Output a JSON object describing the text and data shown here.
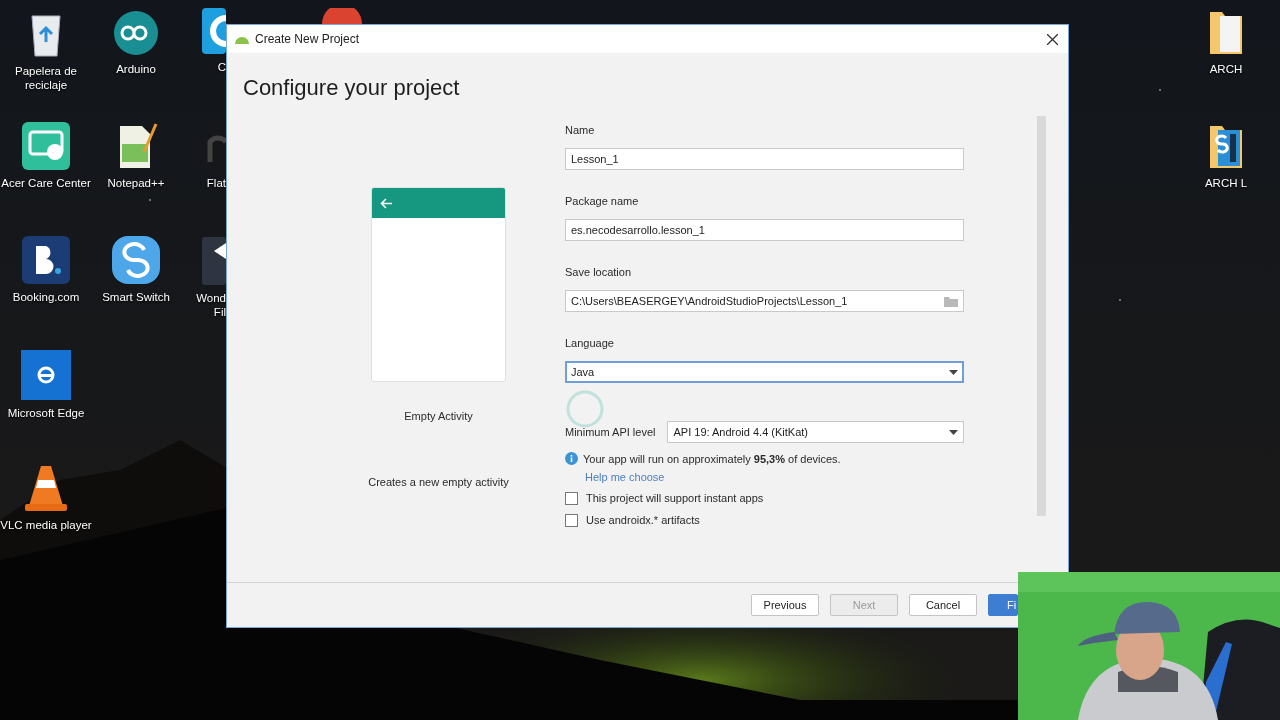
{
  "desktop": {
    "icons": [
      {
        "kind": "recycle-bin",
        "lines": [
          "Papelera de",
          "reciclaje"
        ]
      },
      {
        "kind": "arduino",
        "lines": [
          "Arduino"
        ]
      },
      {
        "kind": "cut-blue",
        "lines": [
          "C"
        ]
      },
      {
        "kind": "cut-red"
      },
      {
        "kind": "acer",
        "lines": [
          "Acer Care Center"
        ]
      },
      {
        "kind": "notepad",
        "lines": [
          "Notepad++"
        ]
      },
      {
        "kind": "cut-dark",
        "lines": [
          "Flat"
        ]
      },
      {
        "kind": "booking",
        "lines": [
          "Booking.com"
        ]
      },
      {
        "kind": "smart-switch",
        "lines": [
          "Smart Switch"
        ]
      },
      {
        "kind": "cut-arrow",
        "lines": [
          "Wond",
          "Fil"
        ]
      },
      {
        "kind": "edge",
        "lines": [
          "Microsoft Edge"
        ]
      },
      {
        "kind": "vlc",
        "lines": [
          "VLC media player"
        ]
      },
      {
        "kind": "folder",
        "lines": [
          "ARCH"
        ]
      },
      {
        "kind": "folder-s",
        "lines": [
          "ARCH L"
        ]
      }
    ]
  },
  "window": {
    "title": "Create New Project",
    "heading": "Configure your project",
    "template": {
      "name": "Empty Activity",
      "description": "Creates a new empty activity"
    },
    "fields": [
      {
        "kind": "text",
        "label": "Name",
        "value": "Lesson_1",
        "focused": false
      },
      {
        "kind": "text",
        "label": "Package name",
        "value": "es.necodesarrollo.lesson_1",
        "focused": false
      },
      {
        "kind": "folder",
        "label": "Save location",
        "value": "C:\\Users\\BEASERGEY\\AndroidStudioProjects\\Lesson_1",
        "focused": false
      },
      {
        "kind": "dropdown",
        "label": "Language",
        "value": "Java",
        "focused": true
      }
    ],
    "min_api": {
      "label": "Minimum API level",
      "value": "API 19: Android 4.4 (KitKat)"
    },
    "info": "Your app will run on approximately **95,3%** of devices.",
    "help_link": "Help me choose",
    "checkboxes": [
      {
        "label": "This project will support instant apps",
        "checked": false
      },
      {
        "label": "Use androidx.* artifacts",
        "checked": false
      }
    ],
    "buttons": [
      {
        "label": "Previous",
        "kind": "normal",
        "disabled": false
      },
      {
        "label": "Next",
        "kind": "normal",
        "disabled": true
      },
      {
        "label": "Cancel",
        "kind": "normal",
        "disabled": false
      },
      {
        "label": "Fi",
        "kind": "primary",
        "disabled": false
      }
    ]
  }
}
